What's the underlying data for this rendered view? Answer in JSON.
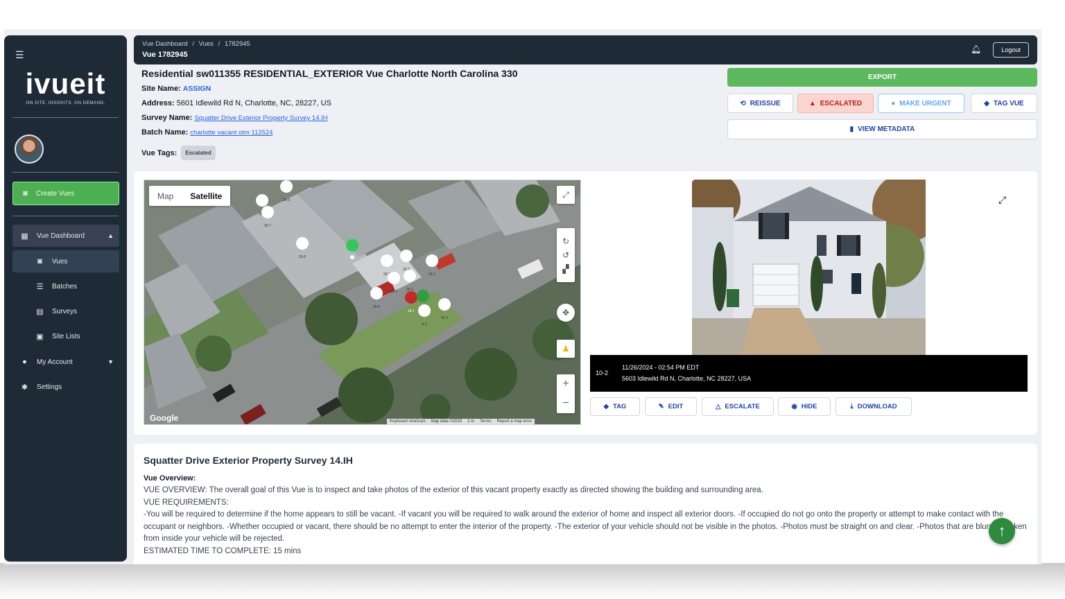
{
  "sidebar": {
    "logo": "ivueit",
    "tagline": "ON SITE. INSIGHTS. ON DEMAND.",
    "create_button": "Create Vues",
    "items": [
      {
        "label": "Vue Dashboard",
        "icon": "dashboard-icon"
      },
      {
        "label": "Vues",
        "icon": "camera-icon"
      },
      {
        "label": "Batches",
        "icon": "list-icon"
      },
      {
        "label": "Surveys",
        "icon": "document-icon"
      },
      {
        "label": "Site Lists",
        "icon": "clipboard-icon"
      },
      {
        "label": "My Account",
        "icon": "account-icon"
      },
      {
        "label": "Settings",
        "icon": "gear-icon"
      }
    ]
  },
  "header": {
    "breadcrumb": [
      "Vue Dashboard",
      "/",
      "Vues",
      "/",
      "1782945"
    ],
    "title": "Vue 1782945",
    "logout": "Logout"
  },
  "vue": {
    "title": "Residential sw011355 RESIDENTIAL_EXTERIOR Vue Charlotte North Carolina 330",
    "site_name_label": "Site Name:",
    "site_name_value": "ASSIGN",
    "address_label": "Address:",
    "address_value": "5601 Idlewild Rd N, Charlotte, NC, 28227, US",
    "survey_name_label": "Survey Name:",
    "survey_name_value": "Squatter Drive Exterior Property Survey 14.IH",
    "batch_name_label": "Batch Name:",
    "batch_name_value": "charlotte vacant otm 112524",
    "tags_label": "Vue Tags:",
    "tags": [
      "Escalated"
    ]
  },
  "actions": {
    "export": "EXPORT",
    "reissue": "REISSUE",
    "escalated": "ESCALATED",
    "make_urgent": "MAKE URGENT",
    "tag_vue": "TAG VUE",
    "view_metadata": "VIEW METADATA"
  },
  "map": {
    "map_tab": "Map",
    "satellite_tab": "Satellite",
    "google": "Google",
    "attribution": [
      "Keyboard shortcuts",
      "Map data ©2025",
      "2 m",
      "Terms",
      "Report a map error"
    ],
    "markers": [
      "26-4",
      "25-9",
      "25-7",
      "25-6",
      "26-2",
      "32-2",
      "32-1",
      "18-2",
      "25-1",
      "25-5",
      "18-1",
      "10-2",
      "9-2",
      "25-3"
    ]
  },
  "photo": {
    "id": "10-2",
    "timestamp": "11/26/2024 - 02:54 PM EDT",
    "address": "5603 Idlewild Rd N, Charlotte, NC 28227, USA",
    "buttons": [
      "TAG",
      "EDIT",
      "ESCALATE",
      "HIDE",
      "DOWNLOAD"
    ]
  },
  "survey": {
    "title": "Squatter Drive Exterior Property Survey 14.IH",
    "overview_heading": "Vue Overview:",
    "lines": [
      "VUE OVERVIEW: The overall goal of this Vue is to inspect and take photos of the exterior of this vacant property exactly as directed showing the building and surrounding area.",
      "VUE REQUIREMENTS:",
      "-You will be required to determine if the home appears to still be vacant. -If vacant you will be required to walk around the exterior of home and inspect all exterior doors. -If occupied do not go onto the property or attempt to make contact with the occupant or neighbors. -Whether occupied or vacant, there should be no attempt to enter the interior of the property. -The exterior of your vehicle should not be visible in the photos. -Photos must be straight on and clear. -Photos that are blurry or taken from inside your vehicle will be rejected.",
      "ESTIMATED TIME TO COMPLETE: 15 mins"
    ]
  },
  "colors": {
    "sidebar_bg": "#1f2a37",
    "export_green": "#5cb85c",
    "escalated_bg": "#fbd5d0",
    "link_blue": "#2563eb"
  }
}
